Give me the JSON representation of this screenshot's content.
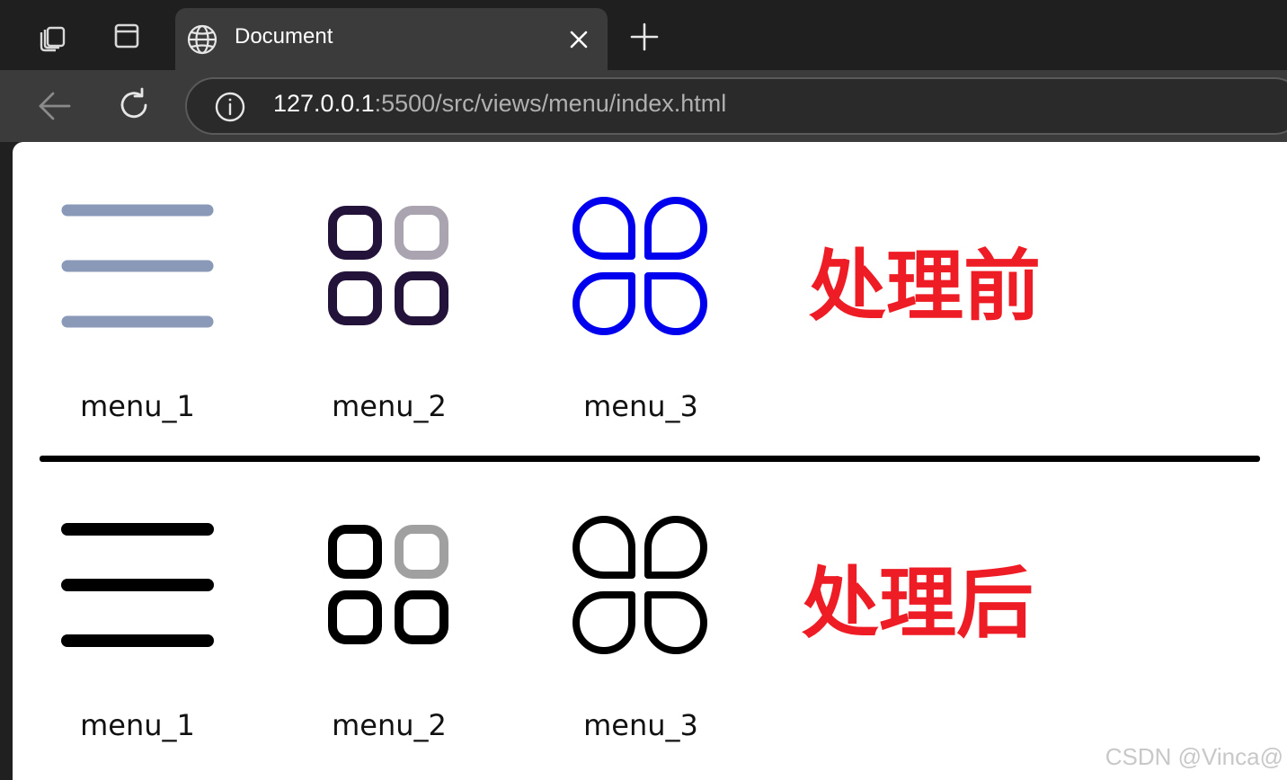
{
  "browser": {
    "tab_title": "Document",
    "url_host": "127.0.0.1",
    "url_rest": ":5500/src/views/menu/index.html"
  },
  "sections": [
    {
      "heading": "处理前",
      "items": [
        {
          "label": "menu_1",
          "icon": "menu-lines-icon",
          "colors": [
            "#8a99b8"
          ]
        },
        {
          "label": "menu_2",
          "icon": "grid-squares-icon",
          "colors": [
            "#23133a",
            "#aaa3b0"
          ]
        },
        {
          "label": "menu_3",
          "icon": "petals-icon",
          "colors": [
            "#0000ee"
          ]
        }
      ]
    },
    {
      "heading": "处理后",
      "items": [
        {
          "label": "menu_1",
          "icon": "menu-lines-icon",
          "colors": [
            "#000000"
          ]
        },
        {
          "label": "menu_2",
          "icon": "grid-squares-icon",
          "colors": [
            "#000000",
            "#a0a0a0"
          ]
        },
        {
          "label": "menu_3",
          "icon": "petals-icon",
          "colors": [
            "#000000"
          ]
        }
      ]
    }
  ],
  "heading_color": "#ee1c25",
  "watermark": "CSDN @Vinca@"
}
